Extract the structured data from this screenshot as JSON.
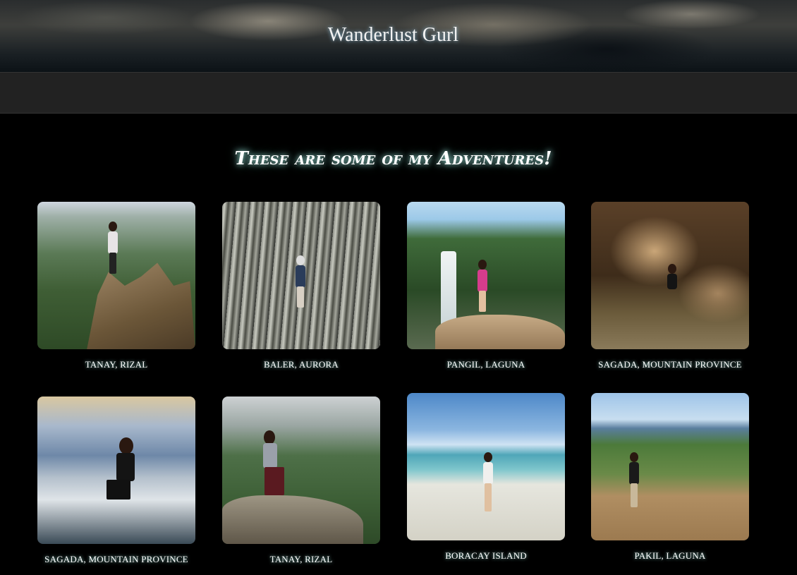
{
  "header": {
    "site_title": "Wanderlust Gurl"
  },
  "main": {
    "heading": "These are some of my Adventures!",
    "gallery": [
      {
        "caption": "TANAY, RIZAL"
      },
      {
        "caption": "BALER, AURORA"
      },
      {
        "caption": "PANGIL, LAGUNA"
      },
      {
        "caption": "SAGADA, MOUNTAIN PROVINCE"
      },
      {
        "caption": "SAGADA, MOUNTAIN PROVINCE"
      },
      {
        "caption": "TANAY, RIZAL"
      },
      {
        "caption": "BORACAY ISLAND"
      },
      {
        "caption": "PAKIL, LAGUNA"
      }
    ]
  }
}
